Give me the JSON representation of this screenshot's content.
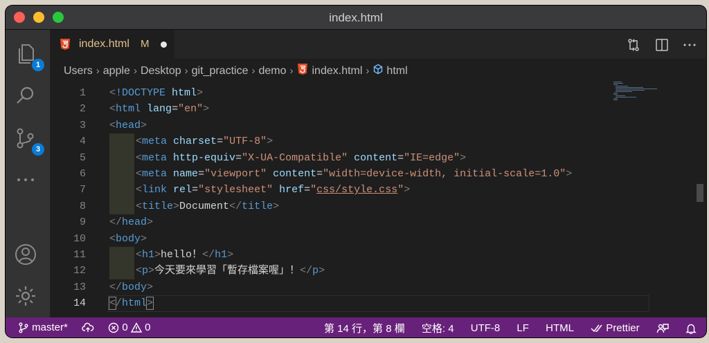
{
  "window": {
    "title": "index.html"
  },
  "activity": {
    "explorer_badge": "1",
    "scm_badge": "3"
  },
  "tab": {
    "label": "index.html",
    "status": "M"
  },
  "breadcrumb": [
    "Users",
    "apple",
    "Desktop",
    "git_practice",
    "demo",
    "index.html",
    "html"
  ],
  "editor": {
    "active_line": "14",
    "lines": [
      {
        "n": "1",
        "indent": 0,
        "tokens": [
          [
            "p",
            "<"
          ],
          [
            "t",
            "!DOCTYPE"
          ],
          [
            "x",
            " "
          ],
          [
            "a",
            "html"
          ],
          [
            "p",
            ">"
          ]
        ]
      },
      {
        "n": "2",
        "indent": 0,
        "tokens": [
          [
            "p",
            "<"
          ],
          [
            "t",
            "html"
          ],
          [
            "x",
            " "
          ],
          [
            "a",
            "lang"
          ],
          [
            "x",
            "="
          ],
          [
            "s",
            "\"en\""
          ],
          [
            "p",
            ">"
          ]
        ]
      },
      {
        "n": "3",
        "indent": 0,
        "tokens": [
          [
            "p",
            "<"
          ],
          [
            "t",
            "head"
          ],
          [
            "p",
            ">"
          ]
        ]
      },
      {
        "n": "4",
        "indent": 1,
        "tokens": [
          [
            "p",
            "<"
          ],
          [
            "t",
            "meta"
          ],
          [
            "x",
            " "
          ],
          [
            "a",
            "charset"
          ],
          [
            "x",
            "="
          ],
          [
            "s",
            "\"UTF-8\""
          ],
          [
            "p",
            ">"
          ]
        ]
      },
      {
        "n": "5",
        "indent": 1,
        "tokens": [
          [
            "p",
            "<"
          ],
          [
            "t",
            "meta"
          ],
          [
            "x",
            " "
          ],
          [
            "a",
            "http-equiv"
          ],
          [
            "x",
            "="
          ],
          [
            "s",
            "\"X-UA-Compatible\""
          ],
          [
            "x",
            " "
          ],
          [
            "a",
            "content"
          ],
          [
            "x",
            "="
          ],
          [
            "s",
            "\"IE=edge\""
          ],
          [
            "p",
            ">"
          ]
        ]
      },
      {
        "n": "6",
        "indent": 1,
        "tokens": [
          [
            "p",
            "<"
          ],
          [
            "t",
            "meta"
          ],
          [
            "x",
            " "
          ],
          [
            "a",
            "name"
          ],
          [
            "x",
            "="
          ],
          [
            "s",
            "\"viewport\""
          ],
          [
            "x",
            " "
          ],
          [
            "a",
            "content"
          ],
          [
            "x",
            "="
          ],
          [
            "s",
            "\"width=device-width, initial-scale=1.0\""
          ],
          [
            "p",
            ">"
          ]
        ]
      },
      {
        "n": "7",
        "indent": 1,
        "tokens": [
          [
            "p",
            "<"
          ],
          [
            "t",
            "link"
          ],
          [
            "x",
            " "
          ],
          [
            "a",
            "rel"
          ],
          [
            "x",
            "="
          ],
          [
            "s",
            "\"stylesheet\""
          ],
          [
            "x",
            " "
          ],
          [
            "a",
            "href"
          ],
          [
            "x",
            "="
          ],
          [
            "s",
            "\""
          ],
          [
            "su",
            "css/style.css"
          ],
          [
            "s",
            "\""
          ],
          [
            "p",
            ">"
          ]
        ]
      },
      {
        "n": "8",
        "indent": 1,
        "tokens": [
          [
            "p",
            "<"
          ],
          [
            "t",
            "title"
          ],
          [
            "p",
            ">"
          ],
          [
            "x",
            "Document"
          ],
          [
            "p",
            "</"
          ],
          [
            "t",
            "title"
          ],
          [
            "p",
            ">"
          ]
        ]
      },
      {
        "n": "9",
        "indent": 0,
        "tokens": [
          [
            "p",
            "</"
          ],
          [
            "t",
            "head"
          ],
          [
            "p",
            ">"
          ]
        ]
      },
      {
        "n": "10",
        "indent": 0,
        "tokens": [
          [
            "p",
            "<"
          ],
          [
            "t",
            "body"
          ],
          [
            "p",
            ">"
          ]
        ]
      },
      {
        "n": "11",
        "indent": 1,
        "tokens": [
          [
            "p",
            "<"
          ],
          [
            "t",
            "h1"
          ],
          [
            "p",
            ">"
          ],
          [
            "x",
            "hello！"
          ],
          [
            "p",
            "</"
          ],
          [
            "t",
            "h1"
          ],
          [
            "p",
            ">"
          ]
        ]
      },
      {
        "n": "12",
        "indent": 1,
        "tokens": [
          [
            "p",
            "<"
          ],
          [
            "t",
            "p"
          ],
          [
            "p",
            ">"
          ],
          [
            "x",
            "今天要來學習「暫存檔案喔」！"
          ],
          [
            "p",
            "</"
          ],
          [
            "t",
            "p"
          ],
          [
            "p",
            ">"
          ]
        ]
      },
      {
        "n": "13",
        "indent": 0,
        "tokens": [
          [
            "p",
            "</"
          ],
          [
            "t",
            "body"
          ],
          [
            "p",
            ">"
          ]
        ]
      },
      {
        "n": "14",
        "indent": 0,
        "tokens": [
          [
            "pb",
            "<"
          ],
          [
            "p",
            "/"
          ],
          [
            "t",
            "html"
          ],
          [
            "pb",
            ">"
          ]
        ]
      }
    ]
  },
  "statusbar": {
    "branch": "master*",
    "errors": "0",
    "warnings": "0",
    "position": "第 14 行，第 8 欄",
    "spaces": "空格: 4",
    "encoding": "UTF-8",
    "eol": "LF",
    "language": "HTML",
    "formatter": "Prettier"
  },
  "colors": {
    "statusbar": "#68217a",
    "badge": "#0a7cd8",
    "modified": "#e2c08d"
  }
}
